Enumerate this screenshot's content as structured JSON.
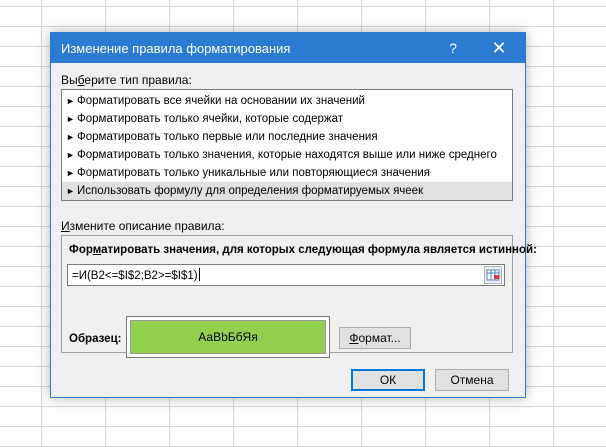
{
  "dialog": {
    "title": "Изменение правила форматирования",
    "help_symbol": "?",
    "close_symbol": "✕"
  },
  "rule_type": {
    "label_prefix": "Вы",
    "label_accel": "б",
    "label_suffix": "ерите тип правила:",
    "items": [
      "Форматировать все ячейки на основании их значений",
      "Форматировать только ячейки, которые содержат",
      "Форматировать только первые или последние значения",
      "Форматировать только значения, которые находятся выше или ниже среднего",
      "Форматировать только уникальные или повторяющиеся значения",
      "Использовать формулу для определения форматируемых ячеек"
    ],
    "selected_index": 5
  },
  "description": {
    "label_accel": "И",
    "label_suffix": "змените описание правила:",
    "heading_prefix": "Фор",
    "heading_accel": "м",
    "heading_suffix": "атировать значения, для которых следующая формула является истинной:",
    "formula": "=И(B2<=$I$2;B2>=$I$1)",
    "sample_label": "Образец:",
    "sample_text": "АаBbБбЯя",
    "sample_fill_color": "#92d050",
    "format_button_accel": "Ф",
    "format_button_suffix": "ормат..."
  },
  "buttons": {
    "ok": "ОК",
    "cancel": "Отмена"
  }
}
